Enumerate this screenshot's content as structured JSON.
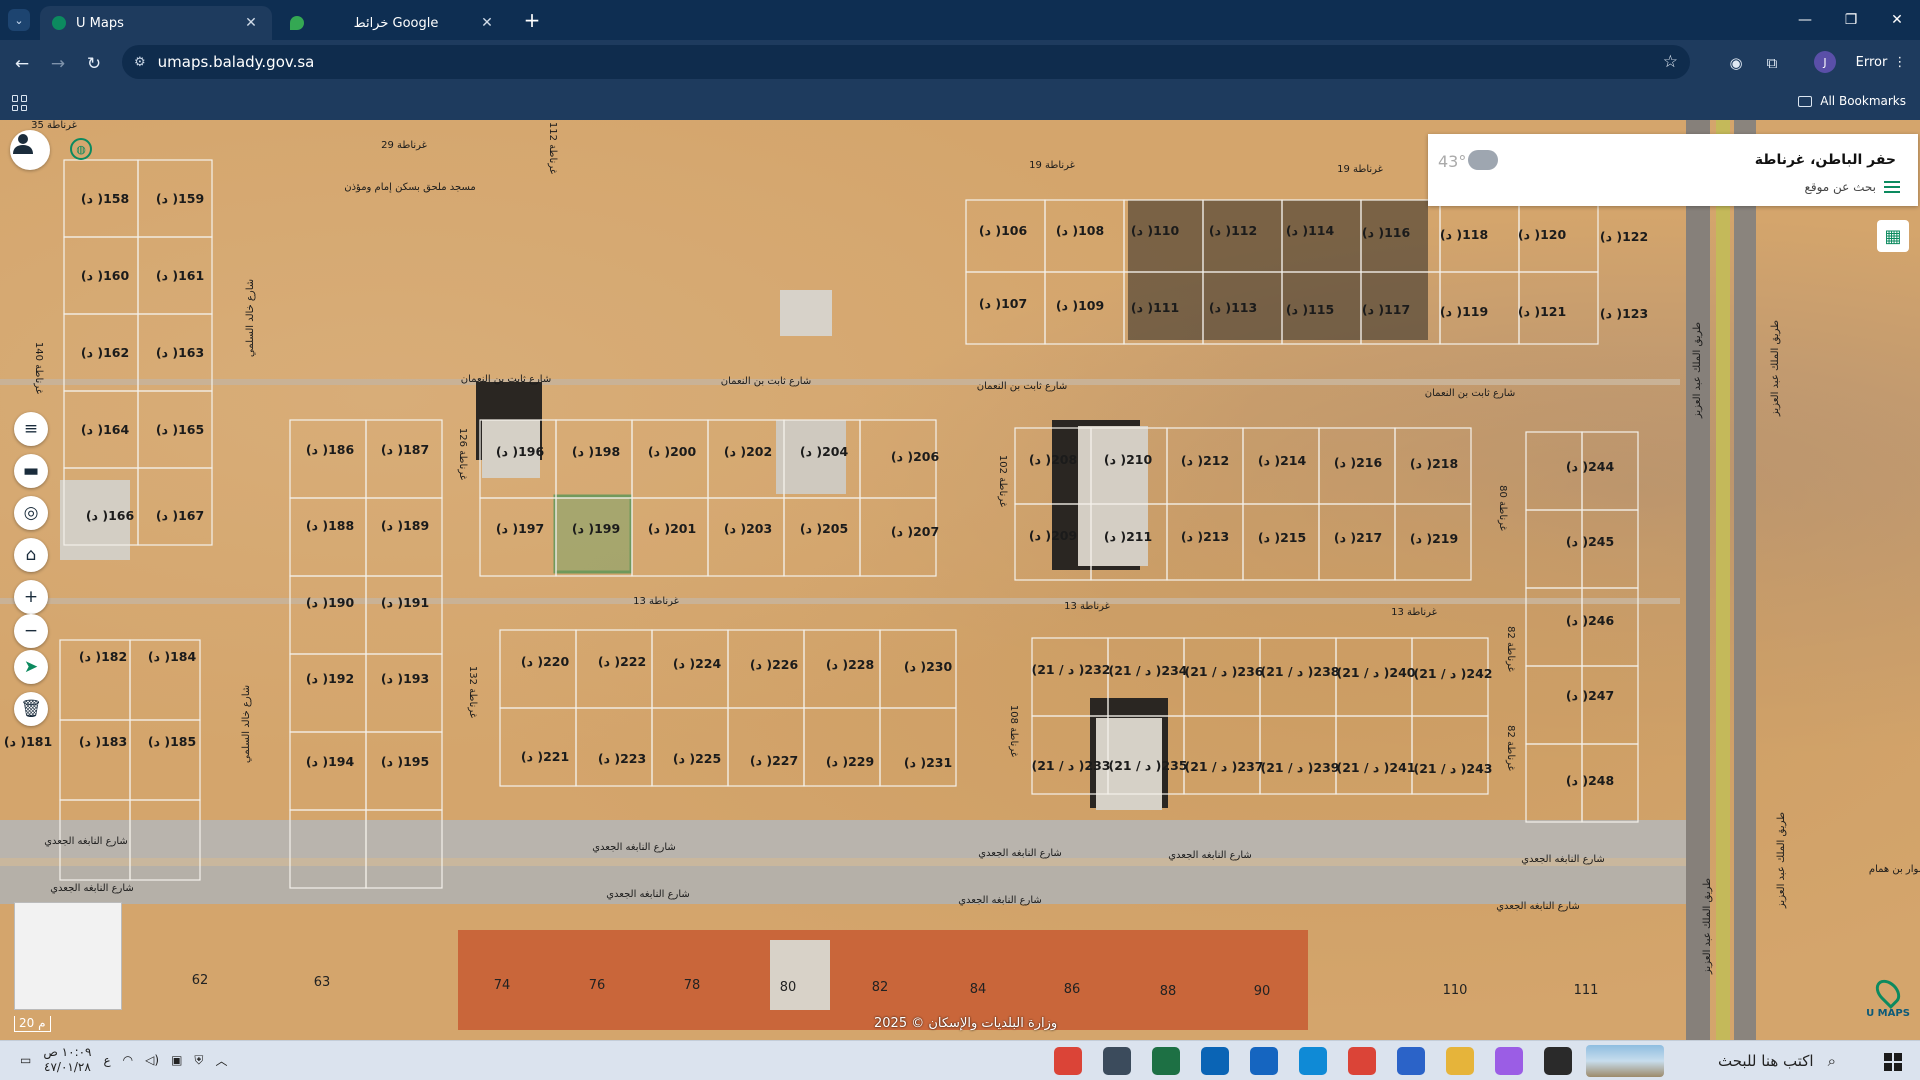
{
  "browser": {
    "tabs": [
      {
        "title": "U Maps",
        "favicon_color": "#0c8a5f"
      },
      {
        "title": "خرائط Google",
        "favicon_color": "#34a853"
      }
    ],
    "url": "umaps.balady.gov.sa",
    "profile_initial": "J",
    "error_label": "Error",
    "bookmarks_label": "All Bookmarks"
  },
  "map": {
    "info": {
      "place": "حفر الباطن، غرناطة",
      "search_label": "بحث عن موقع",
      "temperature": "43°"
    },
    "scale_label": "20 م",
    "copyright": "وزارة البلديات والإسكان © 2025",
    "brand": "U MAPS",
    "highlighted_plot": "199",
    "plots": [
      {
        "label": "(د )158"
      },
      {
        "label": "(د )159"
      },
      {
        "label": "(د )160"
      },
      {
        "label": "(د )161"
      },
      {
        "label": "(د )162"
      },
      {
        "label": "(د )163"
      },
      {
        "label": "(د )164"
      },
      {
        "label": "(د )165"
      },
      {
        "label": "(د )166"
      },
      {
        "label": "(د )167"
      },
      {
        "label": "(د )182"
      },
      {
        "label": "(د )184"
      },
      {
        "label": "(د )181"
      },
      {
        "label": "(د )183"
      },
      {
        "label": "(د )185"
      },
      {
        "label": "(د )186"
      },
      {
        "label": "(د )187"
      },
      {
        "label": "(د )188"
      },
      {
        "label": "(د )189"
      },
      {
        "label": "(د )190"
      },
      {
        "label": "(د )191"
      },
      {
        "label": "(د )192"
      },
      {
        "label": "(د )193"
      },
      {
        "label": "(د )194"
      },
      {
        "label": "(د )195"
      },
      {
        "label": "(د )196"
      },
      {
        "label": "(د )198"
      },
      {
        "label": "(د )200"
      },
      {
        "label": "(د )202"
      },
      {
        "label": "(د )204"
      },
      {
        "label": "(د )206"
      },
      {
        "label": "(د )197"
      },
      {
        "label": "(د )199"
      },
      {
        "label": "(د )201"
      },
      {
        "label": "(د )203"
      },
      {
        "label": "(د )205"
      },
      {
        "label": "(د )207"
      },
      {
        "label": "(د )106"
      },
      {
        "label": "(د )108"
      },
      {
        "label": "(د )110"
      },
      {
        "label": "(د )112"
      },
      {
        "label": "(د )114"
      },
      {
        "label": "(د )116"
      },
      {
        "label": "(د )118"
      },
      {
        "label": "(د )120"
      },
      {
        "label": "(د )122"
      },
      {
        "label": "(د )107"
      },
      {
        "label": "(د )109"
      },
      {
        "label": "(د )111"
      },
      {
        "label": "(د )113"
      },
      {
        "label": "(د )115"
      },
      {
        "label": "(د )117"
      },
      {
        "label": "(د )119"
      },
      {
        "label": "(د )121"
      },
      {
        "label": "(د )123"
      },
      {
        "label": "(د )208"
      },
      {
        "label": "(د )210"
      },
      {
        "label": "(د )212"
      },
      {
        "label": "(د )214"
      },
      {
        "label": "(د )216"
      },
      {
        "label": "(د )218"
      },
      {
        "label": "(د )209"
      },
      {
        "label": "(د )211"
      },
      {
        "label": "(د )213"
      },
      {
        "label": "(د )215"
      },
      {
        "label": "(د )217"
      },
      {
        "label": "(د )219"
      },
      {
        "label": "(د )244"
      },
      {
        "label": "(د )245"
      },
      {
        "label": "(د )246"
      },
      {
        "label": "(د )247"
      },
      {
        "label": "(د )248"
      },
      {
        "label": "(د )220"
      },
      {
        "label": "(د )222"
      },
      {
        "label": "(د )224"
      },
      {
        "label": "(د )226"
      },
      {
        "label": "(د )228"
      },
      {
        "label": "(د )230"
      },
      {
        "label": "(د )221"
      },
      {
        "label": "(د )223"
      },
      {
        "label": "(د )225"
      },
      {
        "label": "(د )227"
      },
      {
        "label": "(د )229"
      },
      {
        "label": "(د )231"
      },
      {
        "label": "(21 / د )232"
      },
      {
        "label": "(21 / د )234"
      },
      {
        "label": "(21 / د )236"
      },
      {
        "label": "(21 / د )238"
      },
      {
        "label": "(21 / د )240"
      },
      {
        "label": "(21 / د )242"
      },
      {
        "label": "(21 / د )233"
      },
      {
        "label": "(21 / د )235"
      },
      {
        "label": "(21 / د )237"
      },
      {
        "label": "(21 / د )239"
      },
      {
        "label": "(21 / د )241"
      },
      {
        "label": "(21 / د )243"
      }
    ],
    "blocks": [
      {
        "label": "62"
      },
      {
        "label": "63"
      },
      {
        "label": "74"
      },
      {
        "label": "76"
      },
      {
        "label": "78"
      },
      {
        "label": "80"
      },
      {
        "label": "82"
      },
      {
        "label": "84"
      },
      {
        "label": "86"
      },
      {
        "label": "88"
      },
      {
        "label": "90"
      },
      {
        "label": "110"
      },
      {
        "label": "111"
      }
    ],
    "streets": [
      {
        "label": "غرناطة 35"
      },
      {
        "label": "غرناطة 29"
      },
      {
        "label": "غرناطة 19"
      },
      {
        "label": "غرناطة 19"
      },
      {
        "label": "شارع ثابت بن النعمان"
      },
      {
        "label": "شارع ثابت بن النعمان"
      },
      {
        "label": "شارع ثابت بن النعمان"
      },
      {
        "label": "شارع ثابت بن النعمان"
      },
      {
        "label": "غرناطة 13"
      },
      {
        "label": "غرناطة 13"
      },
      {
        "label": "غرناطة 13"
      },
      {
        "label": "شارع النابغه الجعدي"
      },
      {
        "label": "شارع النابغه الجعدي"
      },
      {
        "label": "شارع النابغه الجعدي"
      },
      {
        "label": "شارع النابغه الجعدي"
      },
      {
        "label": "شارع النابغه الجعدي"
      },
      {
        "label": "شارع النابغه الجعدي"
      },
      {
        "label": "شارع النابغه الجعدي"
      },
      {
        "label": "شارع النابغه الجعدي"
      },
      {
        "label": "شارع النابغه الجعدي"
      },
      {
        "label": "غرناطة 112"
      },
      {
        "label": "غرناطة 140"
      },
      {
        "label": "غرناطة 126"
      },
      {
        "label": "غرناطة 132"
      },
      {
        "label": "غرناطة 102"
      },
      {
        "label": "غرناطة 108"
      },
      {
        "label": "غرناطة 80"
      },
      {
        "label": "غرناطة 82"
      },
      {
        "label": "غرناطة 82"
      },
      {
        "label": "طريق الملك عبد العزيز"
      },
      {
        "label": "طريق الملك عبد العزيز"
      },
      {
        "label": "طريق الملك عبد العزيز"
      },
      {
        "label": "طريق الملك عبد العزيز"
      },
      {
        "label": "شارع خالد السلمي"
      },
      {
        "label": "شارع خالد السلمي"
      },
      {
        "label": "مسجد ملحق بسكن إمام ومؤذن"
      },
      {
        "label": "سوار بن همام"
      }
    ]
  },
  "taskbar": {
    "time": "١٠:٠٩ ص",
    "date": "٤٧/٠١/٢٨",
    "lang": "ع",
    "search_placeholder": "اكتب هنا للبحث",
    "apps": [
      {
        "name": "chrome",
        "color": "#db4437"
      },
      {
        "name": "calculator",
        "color": "#3b4b5c"
      },
      {
        "name": "excel",
        "color": "#1d7044"
      },
      {
        "name": "outlook",
        "color": "#0a64b5"
      },
      {
        "name": "mail",
        "color": "#1565c0"
      },
      {
        "name": "edge",
        "color": "#0f8ad6"
      },
      {
        "name": "chrome-2",
        "color": "#db4437"
      },
      {
        "name": "store",
        "color": "#2b63c8"
      },
      {
        "name": "file-explorer",
        "color": "#e6b43a"
      },
      {
        "name": "copilot",
        "color": "#9b5de5"
      },
      {
        "name": "task-view",
        "color": "#2a2a2a"
      }
    ]
  }
}
